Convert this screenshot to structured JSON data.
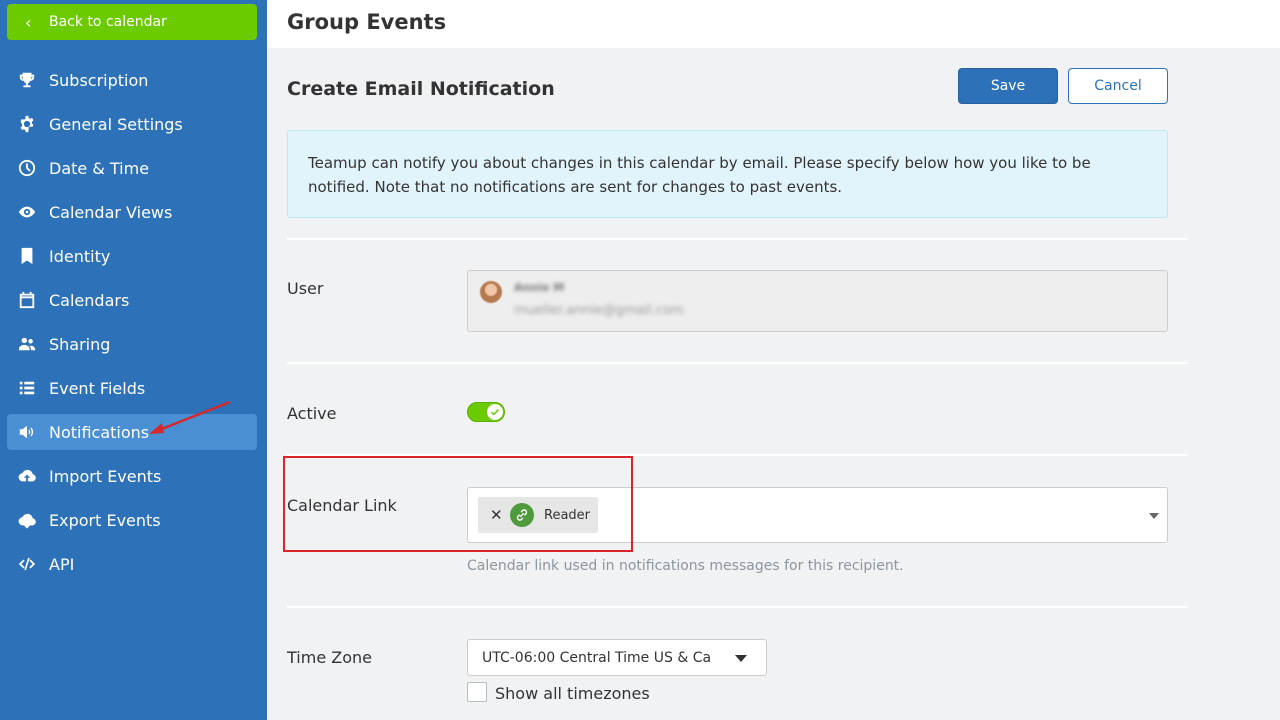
{
  "sidebar": {
    "back_label": "Back to calendar",
    "items": [
      {
        "label": "Subscription",
        "icon": "trophy-icon"
      },
      {
        "label": "General Settings",
        "icon": "gear-icon"
      },
      {
        "label": "Date & Time",
        "icon": "clock-icon"
      },
      {
        "label": "Calendar Views",
        "icon": "eye-icon"
      },
      {
        "label": "Identity",
        "icon": "bookmark-icon"
      },
      {
        "label": "Calendars",
        "icon": "calendar-icon"
      },
      {
        "label": "Sharing",
        "icon": "users-icon"
      },
      {
        "label": "Event Fields",
        "icon": "list-icon"
      },
      {
        "label": "Notifications",
        "icon": "megaphone-icon",
        "active": true
      },
      {
        "label": "Import Events",
        "icon": "cloud-upload-icon"
      },
      {
        "label": "Export Events",
        "icon": "cloud-download-icon"
      },
      {
        "label": "API",
        "icon": "code-icon"
      }
    ]
  },
  "header": {
    "title": "Group Events"
  },
  "page": {
    "title": "Create Email Notification",
    "save_label": "Save",
    "cancel_label": "Cancel",
    "info_text": "Teamup can notify you about changes in this calendar by email. Please specify below how you like to be notified. Note that no notifications are sent for changes to past events."
  },
  "form": {
    "user": {
      "label": "User",
      "name": "Annie M",
      "email": "mueller.annie@gmail.com"
    },
    "active": {
      "label": "Active",
      "enabled": true
    },
    "calendar_link": {
      "label": "Calendar Link",
      "selected": "Reader",
      "remove_glyph": "✕",
      "helper": "Calendar link used in notifications messages for this recipient."
    },
    "time_zone": {
      "label": "Time Zone",
      "value": "UTC-06:00 Central Time US & Ca",
      "show_all_label": "Show all timezones",
      "show_all_checked": false
    }
  },
  "colors": {
    "sidebar": "#2d72b8",
    "accent_green": "#6ccb00",
    "primary": "#2d72b8",
    "highlight": "#d8262a"
  }
}
